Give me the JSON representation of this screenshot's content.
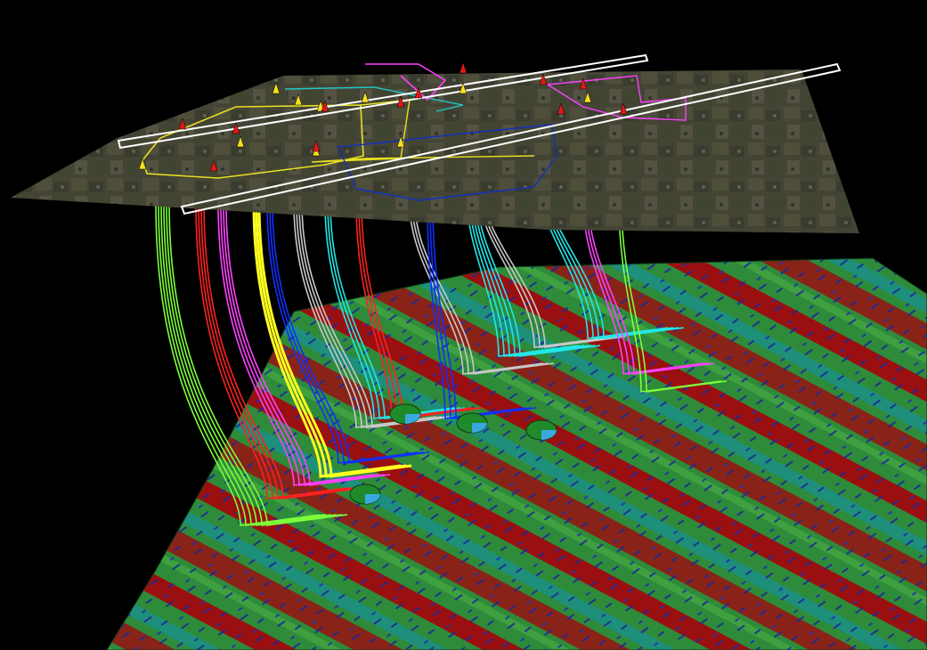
{
  "scene": {
    "background_color": "#000000",
    "surface_layer": "satellite-imagery",
    "subsurface_layer": "seismic-attribute-horizon",
    "well_colors": [
      "#7CFF3A",
      "#FF2020",
      "#FF40FF",
      "#FFFF20",
      "#1030FF",
      "#C8C8C8",
      "#20E8E8",
      "#40FFB0"
    ],
    "horizon_colors": {
      "green": "#2E8B3A",
      "red": "#9A1010",
      "blue": "#1A2A9A",
      "teal": "#1E8F7A"
    },
    "survey_line_color": "#FFFFFF",
    "lease_boundary_colors": [
      "#E8E020",
      "#20C8C8",
      "#FF40FF",
      "#1030C0"
    ],
    "surface_markers": {
      "yellow_count": 10,
      "red_count": 12
    },
    "pie_markers": 4
  }
}
